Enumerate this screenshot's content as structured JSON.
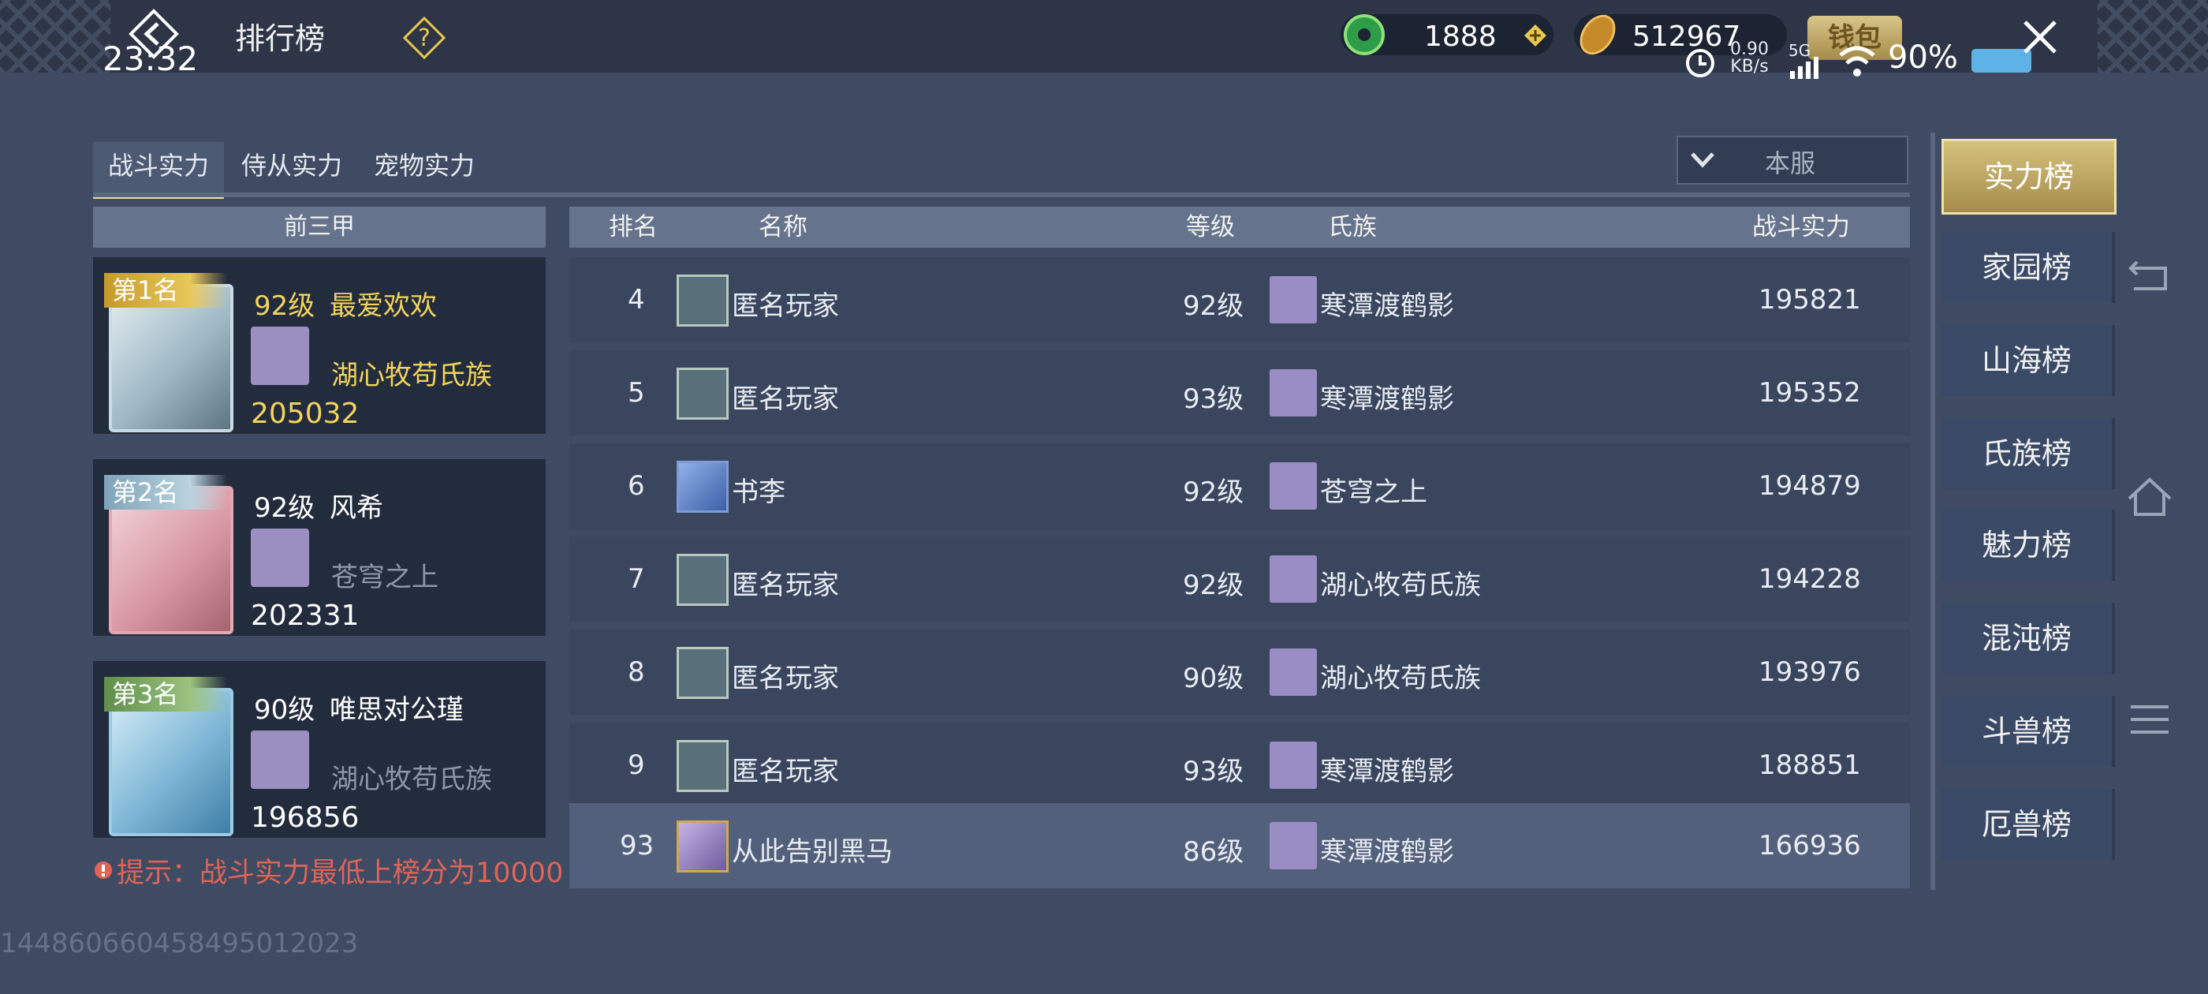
{
  "header": {
    "title": "排行榜",
    "time": "23:32"
  },
  "resources": {
    "jade": "1888",
    "gold": "512967",
    "wallet_label": "钱包"
  },
  "status_bar": {
    "speed_value": "0.90",
    "speed_unit": "KB/s",
    "network": "5G",
    "battery": "90%"
  },
  "tabs": [
    {
      "label": "战斗实力",
      "active": true
    },
    {
      "label": "侍从实力"
    },
    {
      "label": "宠物实力"
    }
  ],
  "server_filter": {
    "selected": "本服"
  },
  "top3": {
    "header": "前三甲",
    "entries": [
      {
        "badge": "第1名",
        "level": "92级",
        "name": "最爱欢欢",
        "clan": "湖心牧苟氏族",
        "power": "205032"
      },
      {
        "badge": "第2名",
        "level": "92级",
        "name": "风希",
        "clan": "苍穹之上",
        "power": "202331"
      },
      {
        "badge": "第3名",
        "level": "90级",
        "name": "唯思对公瑾",
        "clan": "湖心牧苟氏族",
        "power": "196856"
      }
    ]
  },
  "tip": "提示：战斗实力最低上榜分为10000",
  "table": {
    "headers": {
      "rank": "排名",
      "name": "名称",
      "level": "等级",
      "clan": "氏族",
      "power": "战斗实力"
    },
    "rows": [
      {
        "rank": "4",
        "name": "匿名玩家",
        "level": "92级",
        "clan": "寒潭渡鹤影",
        "power": "195821"
      },
      {
        "rank": "5",
        "name": "匿名玩家",
        "level": "93级",
        "clan": "寒潭渡鹤影",
        "power": "195352"
      },
      {
        "rank": "6",
        "name": "书李",
        "level": "92级",
        "clan": "苍穹之上",
        "power": "194879"
      },
      {
        "rank": "7",
        "name": "匿名玩家",
        "level": "92级",
        "clan": "湖心牧苟氏族",
        "power": "194228"
      },
      {
        "rank": "8",
        "name": "匿名玩家",
        "level": "90级",
        "clan": "湖心牧苟氏族",
        "power": "193976"
      },
      {
        "rank": "9",
        "name": "匿名玩家",
        "level": "93级",
        "clan": "寒潭渡鹤影",
        "power": "188851"
      }
    ],
    "self_row": {
      "rank": "93",
      "name": "从此告别黑马",
      "level": "86级",
      "clan": "寒潭渡鹤影",
      "power": "166936"
    }
  },
  "sidebar": [
    {
      "label": "实力榜",
      "active": true
    },
    {
      "label": "家园榜"
    },
    {
      "label": "山海榜"
    },
    {
      "label": "氏族榜"
    },
    {
      "label": "魅力榜"
    },
    {
      "label": "混沌榜"
    },
    {
      "label": "斗兽榜"
    },
    {
      "label": "厄兽榜"
    }
  ],
  "footer_id": "144860660458495012023"
}
